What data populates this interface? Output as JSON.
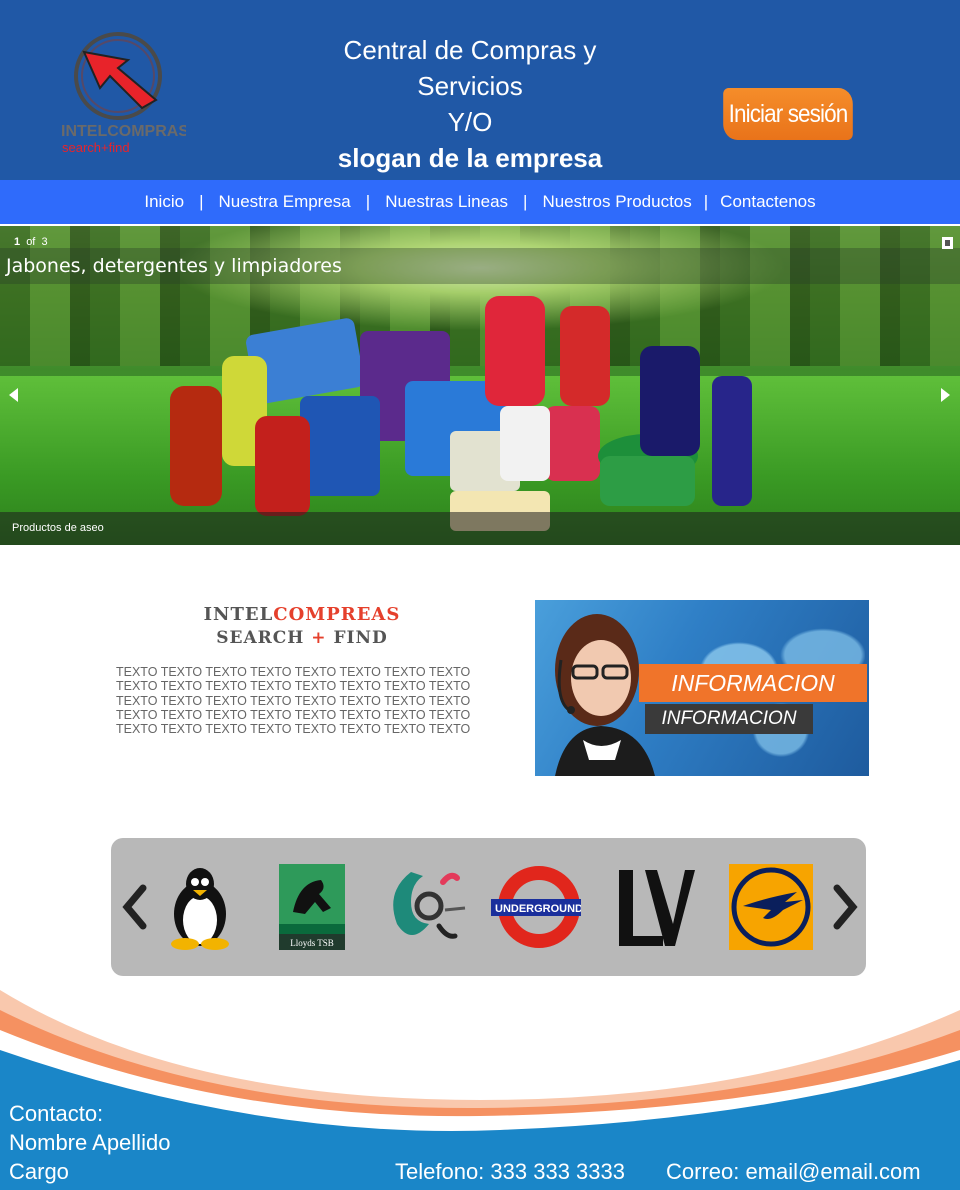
{
  "header": {
    "logo_text_top": "INTELCOMPRAS",
    "logo_text_bottom": "search+find",
    "tagline_line1": "Central de Compras y",
    "tagline_line2": "Servicios",
    "tagline_line3": "Y/O",
    "tagline_line4": "slogan de la empresa",
    "login_label": "Iniciar sesión"
  },
  "nav": {
    "items": [
      {
        "label": "Inicio"
      },
      {
        "label": "Nuestra Empresa"
      },
      {
        "label": "Nuestras Lineas"
      },
      {
        "label": "Nuestros Productos"
      },
      {
        "label": "Contactenos"
      }
    ],
    "separator": "|"
  },
  "slider": {
    "current": "1",
    "of_label": "of",
    "total": "3",
    "title": "Jabones, detergentes y limpiadores",
    "caption": "Productos de aseo"
  },
  "about": {
    "brand_part1": "INTEL",
    "brand_part2": "COMPREAS",
    "brand_line2_a": "SEARCH",
    "brand_line2_plus": "+",
    "brand_line2_b": "FIND",
    "text_lines": [
      "TEXTO TEXTO TEXTO TEXTO TEXTO TEXTO TEXTO TEXTO",
      "TEXTO TEXTO TEXTO TEXTO TEXTO TEXTO TEXTO TEXTO",
      "TEXTO TEXTO TEXTO TEXTO TEXTO TEXTO TEXTO TEXTO",
      "TEXTO TEXTO TEXTO TEXTO TEXTO TEXTO TEXTO TEXTO",
      "TEXTO TEXTO TEXTO TEXTO TEXTO TEXTO TEXTO TEXTO"
    ]
  },
  "info_banner": {
    "label_top": "INFORMACION",
    "label_bottom": "INFORMACION"
  },
  "carousel": {
    "logos": [
      {
        "icon": "linux-tux-icon"
      },
      {
        "icon": "lloyds-tsb-icon",
        "text": "Lloyds TSB"
      },
      {
        "icon": "abstract-swirl-icon"
      },
      {
        "icon": "underground-icon",
        "text": "UNDERGROUND"
      },
      {
        "icon": "louis-vuitton-icon"
      },
      {
        "icon": "lufthansa-icon"
      }
    ]
  },
  "footer": {
    "contact_label": "Contacto:",
    "name": "Nombre Apellido",
    "role": "Cargo",
    "phone": "Telefono: 333 333 3333",
    "email": "Correo: email@email.com"
  },
  "colors": {
    "header_bg": "#2058a6",
    "nav_bg": "#2f6bfb",
    "login_orange": "#f0742a",
    "footer_blue": "#1a86c8",
    "carousel_bg": "#b8b8b8"
  }
}
